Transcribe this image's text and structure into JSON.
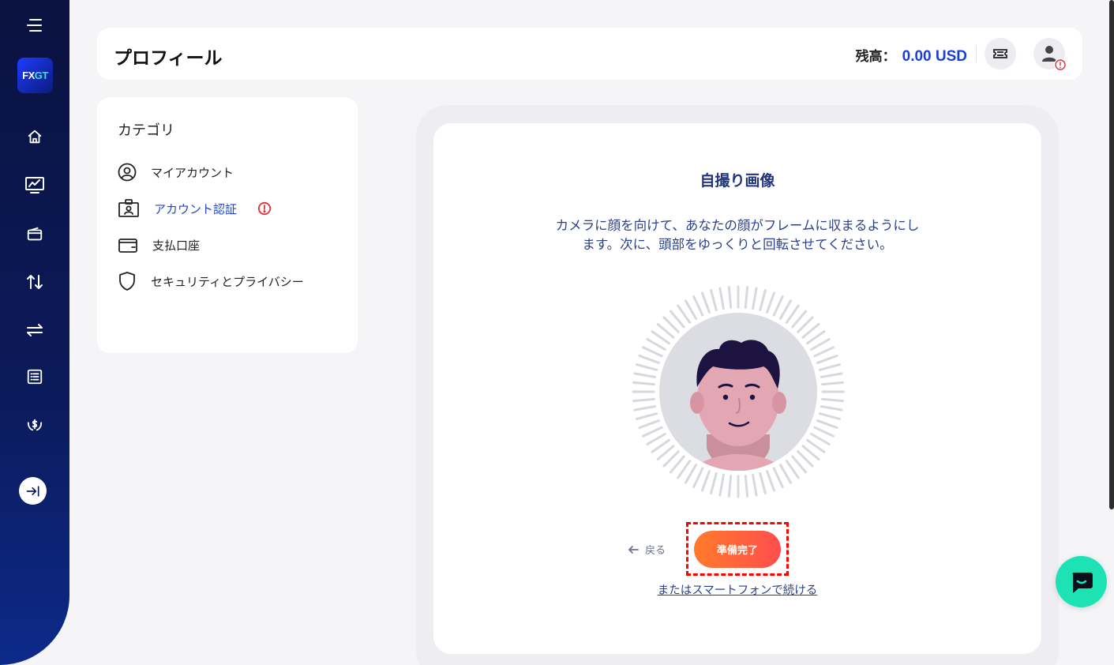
{
  "header": {
    "title": "プロフィール",
    "balance_label": "残高：",
    "balance_value": "0.00 USD"
  },
  "sidebar": {
    "logo_text_fx": "FX",
    "logo_text_gt": "GT",
    "items": [
      {
        "name": "menu-icon"
      },
      {
        "name": "home-icon"
      },
      {
        "name": "chart-icon"
      },
      {
        "name": "wallet-icon"
      },
      {
        "name": "transfer-vertical-icon"
      },
      {
        "name": "exchange-icon"
      },
      {
        "name": "list-icon"
      },
      {
        "name": "hand-money-icon"
      },
      {
        "name": "expand-icon"
      }
    ]
  },
  "category": {
    "title": "カテゴリ",
    "items": [
      {
        "label": "マイアカウント",
        "icon": "user-circle-icon",
        "active": false
      },
      {
        "label": "アカウント認証",
        "icon": "id-card-icon",
        "active": true
      },
      {
        "label": "支払口座",
        "icon": "wallet-icon",
        "active": false
      },
      {
        "label": "セキュリティとプライバシー",
        "icon": "shield-icon",
        "active": false
      }
    ]
  },
  "selfie": {
    "title": "自撮り画像",
    "description_line1": "カメラに顔を向けて、あなたの顔がフレームに収まるようにし",
    "description_line2": "ます。次に、頭部をゆっくりと回転させてください。",
    "back_label": "戻る",
    "ready_label": "準備完了",
    "smartphone_link": "またはスマートフォンで続ける"
  },
  "colors": {
    "sidebar": "#0b1a5a",
    "accent_blue": "#1b3fd6",
    "button_orange": "#ff7a2a",
    "button_red": "#ff4d4d",
    "chat": "#1de2b3",
    "highlight_border": "#ff0000"
  }
}
